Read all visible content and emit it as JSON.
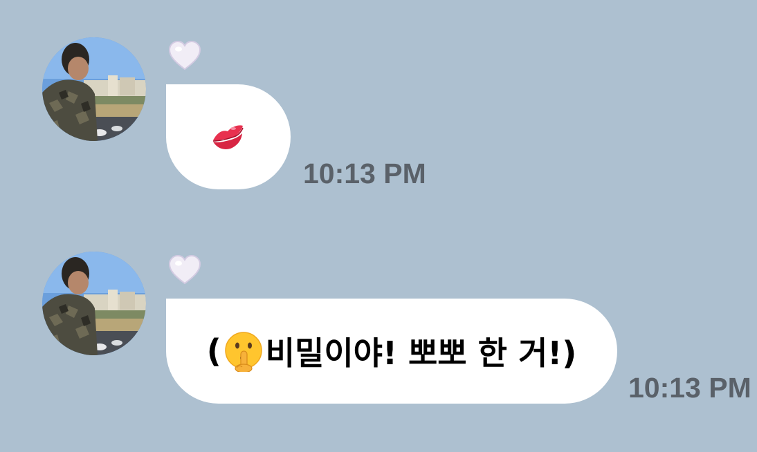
{
  "chat": {
    "messages": [
      {
        "sender_avatar": "avatar-photo",
        "reaction": "white-heart-icon",
        "content_type": "emoji",
        "emoji": "kiss-mark-icon",
        "time": "10:13 PM"
      },
      {
        "sender_avatar": "avatar-photo",
        "reaction": "white-heart-icon",
        "content_type": "text",
        "text_open": "(",
        "inline_emoji": "shushing-face-icon",
        "text_rest": "비밀이야! 뽀뽀 한 거!)",
        "time": "10:13 PM"
      }
    ]
  },
  "colors": {
    "background": "#adc0d0",
    "bubble": "#ffffff",
    "timestamp": "#5a6169",
    "lips": "#e8314f"
  }
}
